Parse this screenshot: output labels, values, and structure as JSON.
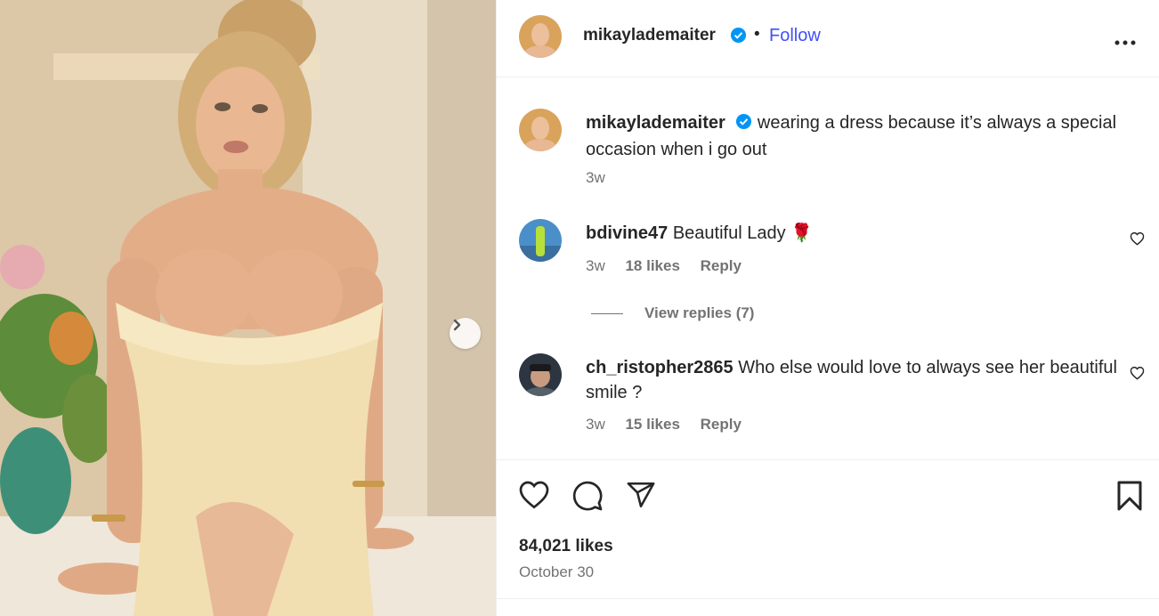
{
  "post": {
    "author": "mikaylademaiter",
    "follow_label": "Follow",
    "dot": "•",
    "caption": {
      "user": "mikaylademaiter",
      "text": "wearing a dress because it’s always a special occasion when i go out",
      "time": "3w"
    },
    "comments": [
      {
        "user": "bdivine47",
        "text": "Beautiful Lady 🌹",
        "time": "3w",
        "likes": "18 likes",
        "reply_label": "Reply",
        "view_replies": "View replies (7)"
      },
      {
        "user": "ch_ristopher2865",
        "text": "Who else would love to always see her beautiful smile ?",
        "time": "3w",
        "likes": "15 likes",
        "reply_label": "Reply"
      }
    ],
    "likes": "84,021 likes",
    "date": "October 30"
  },
  "colors": {
    "follow": "#4150f7",
    "verified": "#0095f6",
    "meta_text": "#737373",
    "border": "#efefef"
  },
  "icons": [
    "chevron-right-icon",
    "verified-badge-icon",
    "more-options-icon",
    "heart-icon",
    "comment-icon",
    "share-icon",
    "bookmark-icon"
  ]
}
